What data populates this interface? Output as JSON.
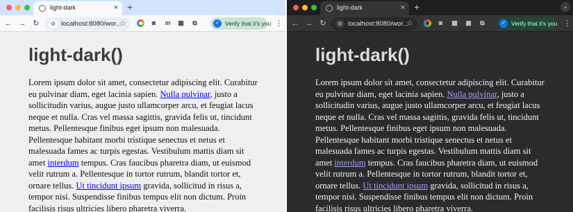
{
  "browser": {
    "tab_title": "light-dark",
    "tab_close": "×",
    "new_tab": "+",
    "url": "localhost:8080/wor...",
    "verify_label": "Verify that it's you",
    "menu_glyph": "⋮",
    "back": "←",
    "forward": "→",
    "reload": "↻",
    "star": "☆",
    "ext_m": "m",
    "profile_menu": "⌄"
  },
  "page": {
    "title": "light-dark()",
    "paragraph": {
      "text_1": "Lorem ipsum dolor sit amet, consectetur adipiscing elit. Curabitur eu pulvinar diam, eget lacinia sapien. ",
      "link_1": "Nulla pulvinar",
      "text_2": ", justo a sollicitudin varius, augue justo ullamcorper arcu, et feugiat lacus neque et nulla. Cras vel massa sagittis, gravida felis ut, tincidunt metus. Pellentesque finibus eget ipsum non malesuada. Pellentesque habitant morbi tristique senectus et netus et malesuada fames ac turpis egestas. Vestibulum mattis diam sit amet ",
      "link_2": "interdum",
      "text_3": " tempus. Cras faucibus pharetra diam, ut euismod velit rutrum a. Pellentesque in tortor rutrum, blandit tortor et, ornare tellus. ",
      "link_3": "Ut tincidunt ipsum",
      "text_4": " gravida, sollicitud in risus a, tempor nisi. Suspendisse finibus tempus elit non dictum. Proin facilisis risus ultricies libero pharetra viverra."
    }
  },
  "colors": {
    "light_background": "#efefef",
    "dark_background": "#2b2b2b",
    "light_link": "#0000ee",
    "dark_link": "#9e9eff",
    "traffic_red": "#fe5f57",
    "traffic_yellow": "#febc2e",
    "traffic_green": "#28c840"
  }
}
